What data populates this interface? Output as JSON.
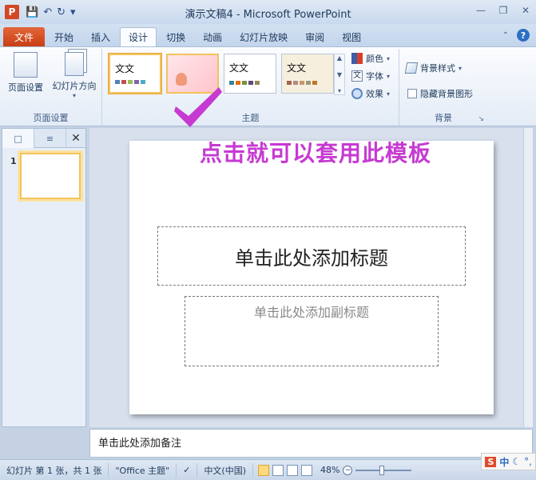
{
  "window": {
    "title": "演示文稿4 - Microsoft PowerPoint",
    "app_icon_letter": "P"
  },
  "tabs": [
    {
      "label": "文件"
    },
    {
      "label": "开始"
    },
    {
      "label": "插入"
    },
    {
      "label": "设计"
    },
    {
      "label": "切换"
    },
    {
      "label": "动画"
    },
    {
      "label": "幻灯片放映"
    },
    {
      "label": "审阅"
    },
    {
      "label": "视图"
    }
  ],
  "active_tab": "设计",
  "ribbon": {
    "page_setup": {
      "page_setup_label": "页面设置",
      "orientation_label": "幻灯片方向",
      "group_label": "页面设置"
    },
    "themes": {
      "thumb_text": "文文",
      "group_label": "主题",
      "colors_label": "颜色",
      "fonts_label": "字体",
      "effects_label": "效果",
      "font_glyph": "文"
    },
    "background": {
      "styles_label": "背景样式",
      "hide_graphics_label": "隐藏背景图形",
      "group_label": "背景"
    }
  },
  "annotation": {
    "text": "点击就可以套用此模板",
    "color": "#c63ad2"
  },
  "slides_pane": {
    "slide_number": "1"
  },
  "slide": {
    "title_placeholder": "单击此处添加标题",
    "subtitle_placeholder": "单击此处添加副标题"
  },
  "notes": {
    "placeholder": "单击此处添加备注"
  },
  "statusbar": {
    "slide_info": "幻灯片 第 1 张，共 1 张",
    "theme": "\"Office 主题\"",
    "language": "中文(中国)",
    "zoom": "48%"
  },
  "ime": {
    "logo": "S",
    "mode": "中"
  }
}
